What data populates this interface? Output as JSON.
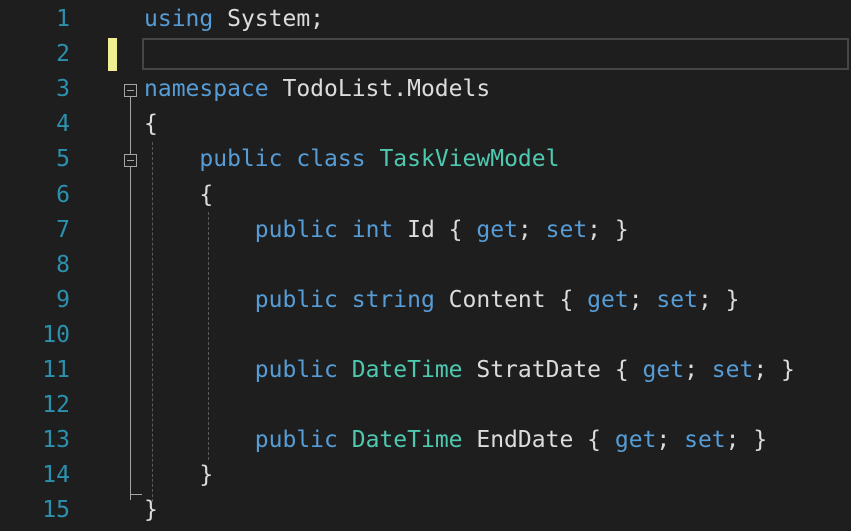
{
  "editor": {
    "line_numbers": [
      "1",
      "2",
      "3",
      "4",
      "5",
      "6",
      "7",
      "8",
      "9",
      "10",
      "11",
      "12",
      "13",
      "14",
      "15"
    ],
    "lines": [
      {
        "indent": "",
        "tokens": [
          {
            "t": "using",
            "c": "kw"
          },
          {
            "t": " System;",
            "c": "plain"
          }
        ]
      },
      {
        "indent": "",
        "tokens": []
      },
      {
        "indent": "",
        "tokens": [
          {
            "t": "namespace",
            "c": "kw"
          },
          {
            "t": " TodoList.Models",
            "c": "plain"
          }
        ]
      },
      {
        "indent": "",
        "tokens": [
          {
            "t": "{",
            "c": "plain"
          }
        ]
      },
      {
        "indent": "    ",
        "tokens": [
          {
            "t": "public",
            "c": "kw"
          },
          {
            "t": " ",
            "c": "plain"
          },
          {
            "t": "class",
            "c": "kw"
          },
          {
            "t": " ",
            "c": "plain"
          },
          {
            "t": "TaskViewModel",
            "c": "type"
          }
        ]
      },
      {
        "indent": "    ",
        "tokens": [
          {
            "t": "{",
            "c": "plain"
          }
        ]
      },
      {
        "indent": "        ",
        "tokens": [
          {
            "t": "public",
            "c": "kw"
          },
          {
            "t": " ",
            "c": "plain"
          },
          {
            "t": "int",
            "c": "kw"
          },
          {
            "t": " Id { ",
            "c": "plain"
          },
          {
            "t": "get",
            "c": "kw"
          },
          {
            "t": "; ",
            "c": "plain"
          },
          {
            "t": "set",
            "c": "kw"
          },
          {
            "t": "; }",
            "c": "plain"
          }
        ]
      },
      {
        "indent": "",
        "tokens": []
      },
      {
        "indent": "        ",
        "tokens": [
          {
            "t": "public",
            "c": "kw"
          },
          {
            "t": " ",
            "c": "plain"
          },
          {
            "t": "string",
            "c": "kw"
          },
          {
            "t": " Content { ",
            "c": "plain"
          },
          {
            "t": "get",
            "c": "kw"
          },
          {
            "t": "; ",
            "c": "plain"
          },
          {
            "t": "set",
            "c": "kw"
          },
          {
            "t": "; }",
            "c": "plain"
          }
        ]
      },
      {
        "indent": "",
        "tokens": []
      },
      {
        "indent": "        ",
        "tokens": [
          {
            "t": "public",
            "c": "kw"
          },
          {
            "t": " ",
            "c": "plain"
          },
          {
            "t": "DateTime",
            "c": "type"
          },
          {
            "t": " StratDate { ",
            "c": "plain"
          },
          {
            "t": "get",
            "c": "kw"
          },
          {
            "t": "; ",
            "c": "plain"
          },
          {
            "t": "set",
            "c": "kw"
          },
          {
            "t": "; }",
            "c": "plain"
          }
        ]
      },
      {
        "indent": "",
        "tokens": []
      },
      {
        "indent": "        ",
        "tokens": [
          {
            "t": "public",
            "c": "kw"
          },
          {
            "t": " ",
            "c": "plain"
          },
          {
            "t": "DateTime",
            "c": "type"
          },
          {
            "t": " EndDate { ",
            "c": "plain"
          },
          {
            "t": "get",
            "c": "kw"
          },
          {
            "t": "; ",
            "c": "plain"
          },
          {
            "t": "set",
            "c": "kw"
          },
          {
            "t": "; }",
            "c": "plain"
          }
        ]
      },
      {
        "indent": "    ",
        "tokens": [
          {
            "t": "}",
            "c": "plain"
          }
        ]
      },
      {
        "indent": "",
        "tokens": [
          {
            "t": "}",
            "c": "plain"
          }
        ]
      }
    ],
    "colors": {
      "background": "#1e1e1e",
      "keyword": "#569cd6",
      "type": "#4ec9b0",
      "text": "#dcdcdc",
      "line_number": "#2b91af",
      "change_marker": "#efef91"
    }
  }
}
